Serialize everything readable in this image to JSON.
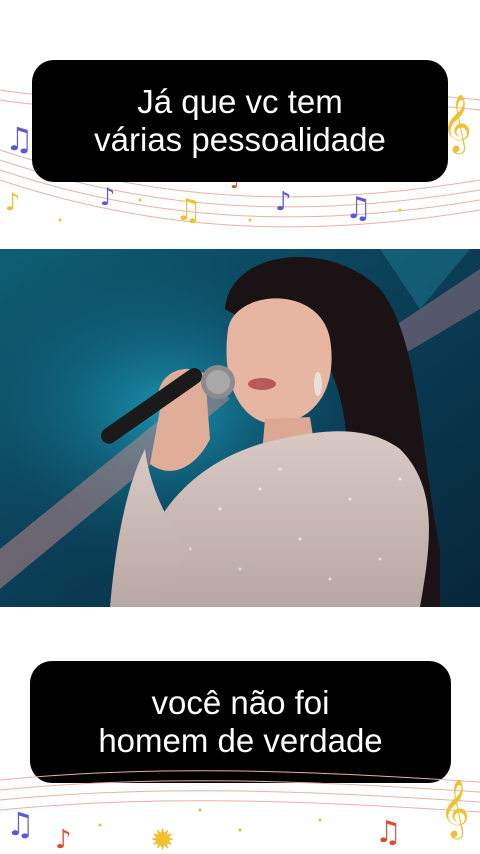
{
  "captions": {
    "top": [
      "Já que vc tem",
      "várias pessoalidade"
    ],
    "bottom": [
      "você não foi",
      "homem de verdade"
    ]
  },
  "colors": {
    "caption_bg": "#000000",
    "caption_text": "#ffffff",
    "note_blue": "#5a5ad6",
    "note_gold": "#f0c030",
    "note_red": "#e04a30",
    "staff_line": "#e8b0a8"
  },
  "icons": [
    "music-note-icon",
    "treble-clef-icon",
    "sun-icon"
  ]
}
